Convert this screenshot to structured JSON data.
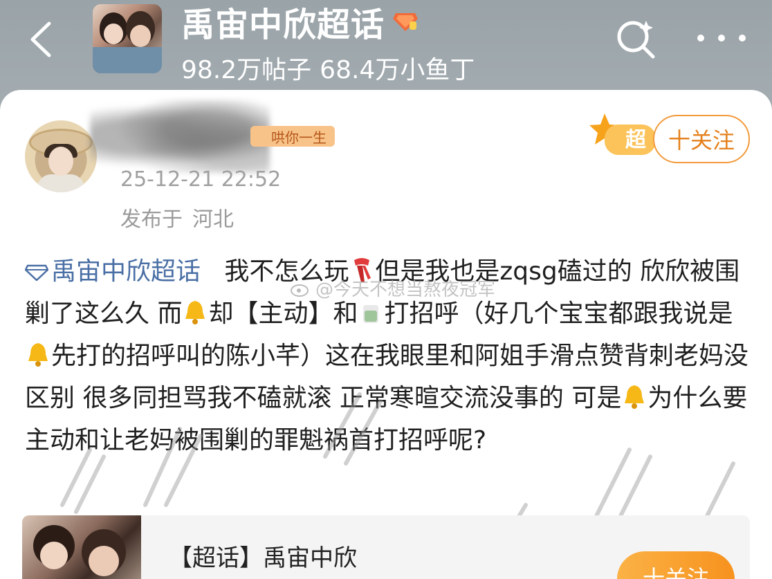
{
  "header": {
    "title": "禹宙中欣超话",
    "posts_count": "98.2万帖子",
    "fans_count": "68.4万小鱼丁"
  },
  "post": {
    "fan_badge": "哄你一生",
    "time": "25-12-21 22:52",
    "location_prefix": "发布于",
    "location": "河北",
    "super_badge": "超",
    "follow_label": "十关注",
    "topic_tag": "禹宙中欣超话",
    "watermark": "@今天不想当熬夜冠军",
    "text": {
      "p1": "我不怎么玩",
      "p2": "但是我也是zqsg磕过的 欣欣被围剿了这么久 而",
      "p3": "却【主动】和",
      "p4": "打招呼（好几个宝宝都跟我说是",
      "p5": "先打的招呼叫的陈小芊）这在我眼里和阿姐手滑点赞背刺老妈没区别 很多同担骂我不磕就滚 正常寒暄交流没事的 可是",
      "p6": "为什么要主动和让老妈被围剿的罪魁祸首打招呼呢?"
    }
  },
  "topic_card": {
    "title": "【超话】禹宙中欣",
    "follow_label": "十关注"
  },
  "colors": {
    "accent_orange": "#f39a3b",
    "topic_blue": "#4a6fa5",
    "header_bg": "#a3abb0"
  }
}
